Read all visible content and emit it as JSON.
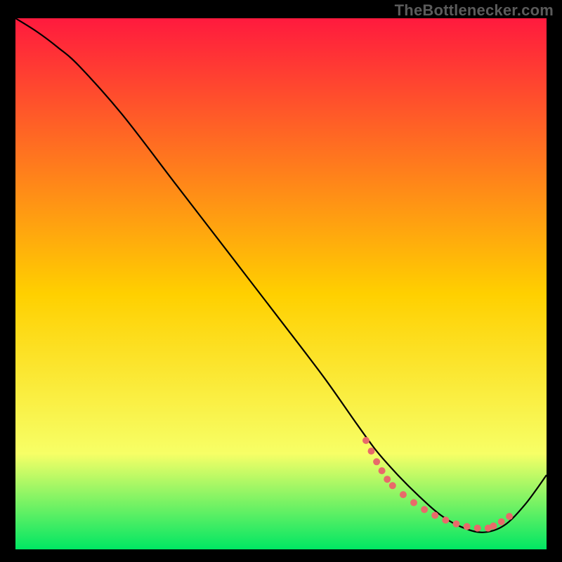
{
  "watermark": "TheBottlenecker.com",
  "colors": {
    "top": "#ff1a3e",
    "mid": "#ffd000",
    "low": "#f7ff66",
    "bottom": "#00e663",
    "curve": "#000000",
    "dot": "#e86a6a",
    "frame": "#000000"
  },
  "chart_data": {
    "type": "line",
    "title": "",
    "xlabel": "",
    "ylabel": "",
    "xlim": [
      0,
      100
    ],
    "ylim": [
      0,
      100
    ],
    "curve": {
      "x": [
        0,
        4,
        8,
        12,
        20,
        30,
        40,
        50,
        58,
        64,
        68,
        72,
        76,
        80,
        84,
        88,
        92,
        96,
        100
      ],
      "y": [
        100,
        97.5,
        94.5,
        91,
        82,
        69,
        56,
        43,
        32.5,
        24,
        18.5,
        14,
        10,
        6.5,
        4.2,
        3.2,
        4.5,
        8.5,
        14
      ]
    },
    "dotted_band": {
      "left": {
        "x": [
          66,
          67,
          68,
          69,
          70
        ],
        "y": [
          20.5,
          18.5,
          16.5,
          14.8,
          13.2
        ]
      },
      "floor": {
        "x": [
          71,
          73,
          75,
          77,
          79,
          81,
          83,
          85,
          87,
          89
        ],
        "y": [
          12.0,
          10.3,
          8.8,
          7.5,
          6.4,
          5.5,
          4.8,
          4.3,
          4.0,
          4.0
        ]
      },
      "right": {
        "x": [
          90,
          91.5,
          93
        ],
        "y": [
          4.4,
          5.2,
          6.2
        ]
      }
    },
    "dot_radius_px": 5
  }
}
